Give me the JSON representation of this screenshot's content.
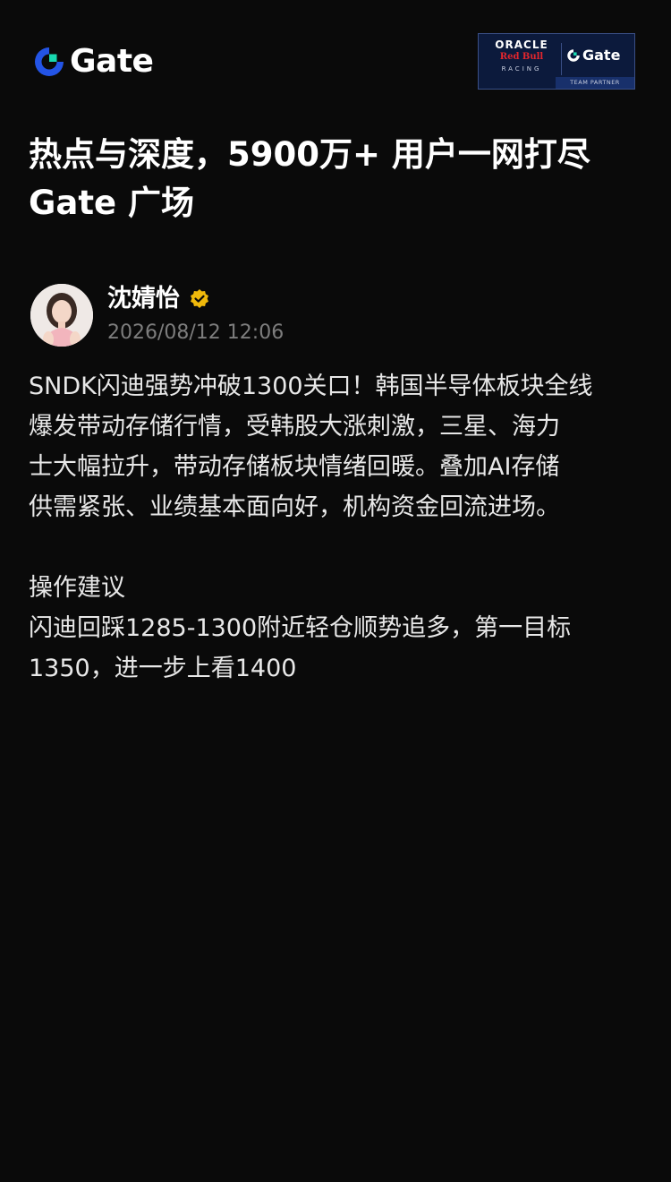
{
  "header": {
    "brand_name": "Gate",
    "partner": {
      "oracle": "ORACLE",
      "redbull": "Red Bull",
      "racing": "RACING",
      "brand": "Gate",
      "strip": "TEAM PARTNER"
    }
  },
  "headline": {
    "line1": "热点与深度，5900万+ 用户一网打尽",
    "line2": "Gate 广场"
  },
  "author": {
    "name": "沈婧怡",
    "time": "2026/08/12 12:06"
  },
  "post": {
    "line1": "SNDK闪迪强势冲破1300关口！韩国半导体板块全线",
    "line2": "爆发带动存储行情，受韩股大涨刺激，三星、海力",
    "line3": "士大幅拉升，带动存储板块情绪回暖。叠加AI存储",
    "line4": "供需紧张、业绩基本面向好，机构资金回流进场。",
    "line5": "操作建议",
    "line6": "闪迪回踩1285-1300附近轻仓顺势追多，第一目标",
    "line7": "1350，进一步上看1400"
  },
  "colors": {
    "background": "#0a0a0a",
    "gate_blue": "#2354e6",
    "gate_green": "#18d9b0",
    "verified_gold": "#f0b90b",
    "timestamp": "#7d7d7d"
  }
}
